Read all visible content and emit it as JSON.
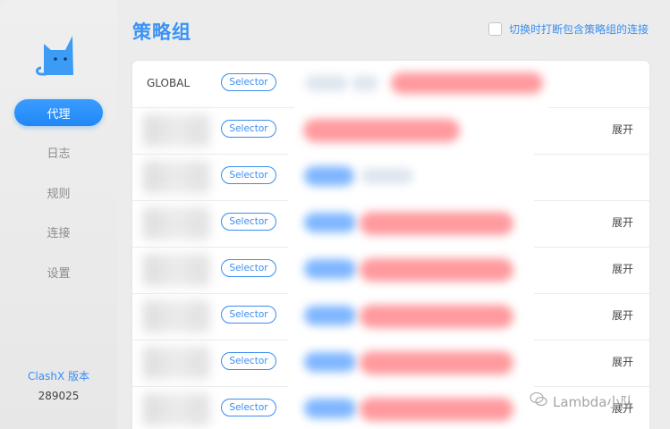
{
  "window": {
    "controls": [
      "close",
      "minimize",
      "maximize"
    ]
  },
  "sidebar": {
    "logo_icon": "cat-icon",
    "items": [
      {
        "label": "代理",
        "active": true
      },
      {
        "label": "日志",
        "active": false
      },
      {
        "label": "规则",
        "active": false
      },
      {
        "label": "连接",
        "active": false
      },
      {
        "label": "设置",
        "active": false
      }
    ],
    "version_label": "ClashX 版本",
    "version_number": "289025"
  },
  "main": {
    "title": "策略组",
    "option_label": "切换时打断包含策略组的连接",
    "option_checked": false,
    "rows": [
      {
        "name": "GLOBAL",
        "type": "Selector",
        "expand": ""
      },
      {
        "name": "",
        "type": "Selector",
        "expand": "展开"
      },
      {
        "name": "",
        "type": "Selector",
        "expand": ""
      },
      {
        "name": "",
        "type": "Selector",
        "expand": "展开"
      },
      {
        "name": "",
        "type": "Selector",
        "expand": "展开"
      },
      {
        "name": "",
        "type": "Selector",
        "expand": "展开"
      },
      {
        "name": "",
        "type": "Selector",
        "expand": "展开"
      },
      {
        "name": "",
        "type": "Selector",
        "expand": "展开"
      }
    ]
  },
  "watermark": {
    "text": "Lambda小队"
  },
  "colors": {
    "accent": "#3a8ef0",
    "active_nav": "#2a8ff7"
  }
}
